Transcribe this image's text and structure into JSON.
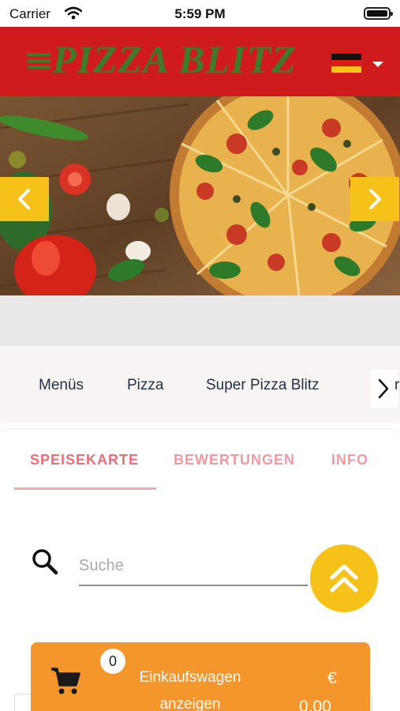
{
  "status_bar": {
    "carrier": "Carrier",
    "time": "5:59 PM"
  },
  "header": {
    "brand": "PIZZA BLITZ",
    "colors": {
      "background": "#cf1b1b",
      "brand": "#3e7a28"
    },
    "language_flag": "germany-flag-icon"
  },
  "hero": {
    "image": "pizza-hero-image",
    "prev_icon": "chevron-left-icon",
    "next_icon": "chevron-right-icon"
  },
  "categories": {
    "items": [
      "Menüs",
      "Pizza",
      "Super Pizza Blitz"
    ],
    "overflow_text": "r",
    "next_icon": "chevron-right-icon"
  },
  "tabs": {
    "items": [
      "SPEISEKARTE",
      "BEWERTUNGEN",
      "INFO"
    ],
    "active": "SPEISEKARTE",
    "accent": "#e5707a"
  },
  "search": {
    "placeholder": "Suche",
    "value": ""
  },
  "cart": {
    "count": "0",
    "label": "Einkaufswagen anzeigen",
    "currency": "€",
    "total": "0,00",
    "color": "#f5962c"
  },
  "scroll_top_color": "#f6c21a"
}
